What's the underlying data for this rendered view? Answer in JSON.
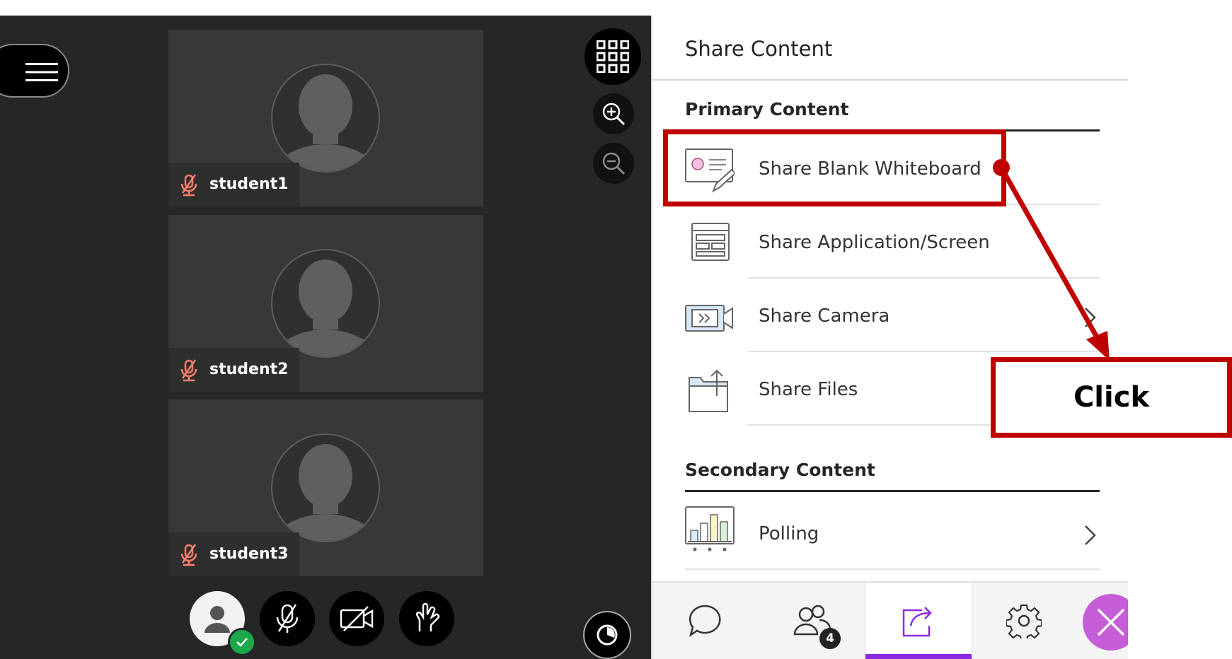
{
  "participants": [
    {
      "name": "student1"
    },
    {
      "name": "student2"
    },
    {
      "name": "student3"
    }
  ],
  "panel": {
    "title": "Share Content",
    "primary_label": "Primary Content",
    "secondary_label": "Secondary Content",
    "primary_items": [
      {
        "label": "Share Blank Whiteboard",
        "icon": "whiteboard-icon"
      },
      {
        "label": "Share Application/Screen",
        "icon": "app-screen-icon"
      },
      {
        "label": "Share Camera",
        "icon": "camera-icon"
      },
      {
        "label": "Share Files",
        "icon": "files-icon"
      }
    ],
    "secondary_items": [
      {
        "label": "Polling",
        "icon": "polling-icon"
      }
    ]
  },
  "bottom_nav": {
    "attendee_badge": "4",
    "active_tab": "share-content",
    "accent_color": "#8a2be2"
  },
  "annotation": {
    "text": "Click",
    "color": "#c00000"
  }
}
